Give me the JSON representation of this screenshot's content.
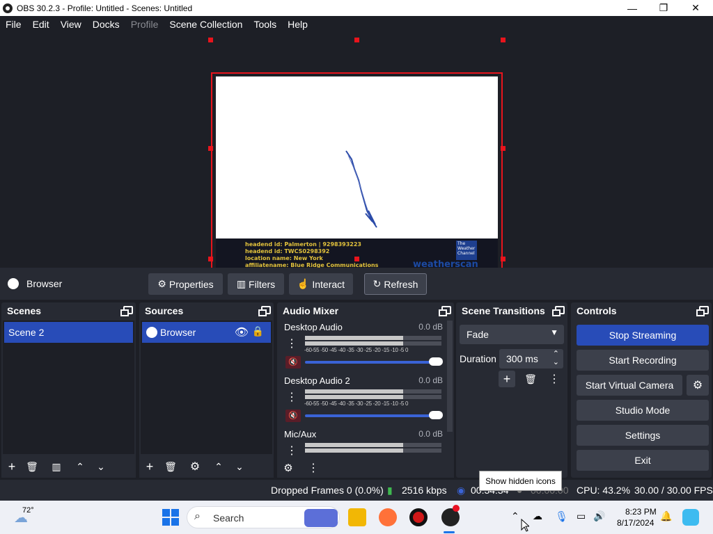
{
  "window": {
    "title": "OBS 30.2.3 - Profile: Untitled - Scenes: Untitled",
    "minimize": "—",
    "maximize": "❐",
    "close": "✕"
  },
  "menu": [
    "File",
    "Edit",
    "View",
    "Docks",
    "Profile",
    "Scene Collection",
    "Tools",
    "Help"
  ],
  "preview": {
    "ticker_lines": [
      "headend id: Palmerton | 9298393223",
      "headend id: TWCS0298392",
      "location name: New York",
      "affiliatename: Blue Ridge Communications"
    ],
    "logo_text": "The Weather Channel",
    "brand_text": "weatherscan"
  },
  "context_bar": {
    "source_name": "Browser",
    "properties": "Properties",
    "filters": "Filters",
    "interact": "Interact",
    "refresh": "Refresh"
  },
  "scenes": {
    "title": "Scenes",
    "items": [
      "Scene 2"
    ]
  },
  "sources": {
    "title": "Sources",
    "items": [
      "Browser"
    ]
  },
  "mixer": {
    "title": "Audio Mixer",
    "ticks": "-60-55 -50 -45 -40 -35 -30 -25 -20 -15 -10  -5  0",
    "channels": [
      {
        "name": "Desktop Audio",
        "db": "0.0 dB",
        "level": 0.72,
        "volume": 1.0
      },
      {
        "name": "Desktop Audio 2",
        "db": "0.0 dB",
        "level": 0.72,
        "volume": 1.0
      },
      {
        "name": "Mic/Aux",
        "db": "0.0 dB",
        "level": 0.72,
        "volume": 1.0
      }
    ]
  },
  "transitions": {
    "title": "Scene Transitions",
    "selected": "Fade",
    "duration_label": "Duration",
    "duration_value": "300 ms"
  },
  "controls": {
    "title": "Controls",
    "stop_streaming": "Stop Streaming",
    "start_recording": "Start Recording",
    "start_virtual_camera": "Start Virtual Camera",
    "studio_mode": "Studio Mode",
    "settings": "Settings",
    "exit": "Exit"
  },
  "status": {
    "dropped_frames": "Dropped Frames 0 (0.0%)",
    "bitrate": "2516 kbps",
    "stream_time": "00:34:34",
    "record_time": "00:00:00",
    "cpu": "CPU: 43.2%",
    "fps": "30.00 / 30.00 FPS",
    "tooltip": "Show hidden icons"
  },
  "taskbar": {
    "weather": "72°",
    "search_placeholder": "Search",
    "time": "8:23 PM",
    "date": "8/17/2024"
  },
  "colors": {
    "accent": "#284cb8",
    "selection_red": "#e8141c",
    "mute_red": "#ff5b6a"
  }
}
